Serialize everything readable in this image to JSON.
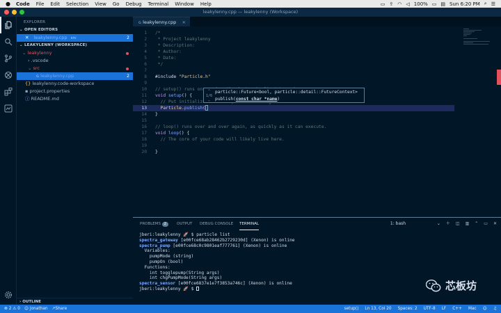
{
  "menubar": {
    "app": "Code",
    "items": [
      "File",
      "Edit",
      "Selection",
      "View",
      "Go",
      "Debug",
      "Terminal",
      "Window",
      "Help"
    ],
    "battery": "100%",
    "clock": "Sun 6:20 PM"
  },
  "window": {
    "title": "leakylenny.cpp — leakylenny (Workspace)"
  },
  "sidebar": {
    "title": "EXPLORER",
    "open_editors_header": "OPEN EDITORS",
    "open_editor_file": "leakylenny.cpp",
    "open_editor_path": "src",
    "workspace_header": "LEAKYLENNY (WORKSPACE)",
    "tree": {
      "root": "leakylenny",
      "vscode": ".vscode",
      "src": "src",
      "cpp": "leakylenny.cpp",
      "cpp_badge": "2",
      "workspace_file": "leakylenny.code-workspace",
      "properties": "project.properties",
      "readme": "README.md"
    },
    "outline_header": "OUTLINE"
  },
  "tab": {
    "label": "leakylenny.cpp",
    "close": "×"
  },
  "editor": {
    "lines": [
      {
        "n": "1",
        "parts": [
          [
            "cmt",
            "/*"
          ]
        ]
      },
      {
        "n": "2",
        "parts": [
          [
            "cmt",
            " * Project leakylenny"
          ]
        ]
      },
      {
        "n": "3",
        "parts": [
          [
            "cmt",
            " * Description:"
          ]
        ]
      },
      {
        "n": "4",
        "parts": [
          [
            "cmt",
            " * Author:"
          ]
        ]
      },
      {
        "n": "5",
        "parts": [
          [
            "cmt",
            " * Date:"
          ]
        ]
      },
      {
        "n": "6",
        "parts": [
          [
            "cmt",
            " */"
          ]
        ]
      },
      {
        "n": "7",
        "parts": []
      },
      {
        "n": "8",
        "parts": [
          [
            "pl",
            "#include "
          ],
          [
            "str",
            "\"Particle.h\""
          ]
        ]
      },
      {
        "n": "9",
        "parts": []
      },
      {
        "n": "10",
        "parts": [
          [
            "cmt",
            "// setup() runs once, when the device is first turned on."
          ]
        ]
      },
      {
        "n": "11",
        "parts": [
          [
            "kw",
            "void "
          ],
          [
            "fn",
            "setup"
          ],
          [
            "pl",
            "() {"
          ]
        ]
      },
      {
        "n": "12",
        "parts": [
          [
            "cmt",
            "  // Put initialization like pinMode and begin functions here."
          ]
        ]
      },
      {
        "n": "13",
        "parts": [
          [
            "pl",
            "  "
          ],
          [
            "cl",
            "Particle"
          ],
          [
            "pl",
            "."
          ],
          [
            "fn",
            "publish"
          ],
          [
            "pl",
            "("
          ]
        ]
      },
      {
        "n": "14",
        "parts": [
          [
            "pl",
            "}"
          ]
        ]
      },
      {
        "n": "15",
        "parts": []
      },
      {
        "n": "16",
        "parts": [
          [
            "cmt",
            "// loop() runs over and over again, as quickly as it can execute."
          ]
        ]
      },
      {
        "n": "17",
        "parts": [
          [
            "kw",
            "void "
          ],
          [
            "fn",
            "loop"
          ],
          [
            "pl",
            "() {"
          ]
        ]
      },
      {
        "n": "18",
        "parts": [
          [
            "cmt",
            "  // The core of your code will likely live here."
          ]
        ]
      },
      {
        "n": "19",
        "parts": []
      },
      {
        "n": "20",
        "parts": [
          [
            "pl",
            "}"
          ]
        ]
      }
    ],
    "current_line": "13"
  },
  "hover": {
    "counter": "1/6",
    "signature_1": "particle::Future<bool, particle::detail::FutureContext>",
    "signature_2_prefix": "publish(",
    "signature_2_param": "const char *name",
    "signature_2_suffix": ")"
  },
  "panel": {
    "tabs": [
      "PROBLEMS",
      "OUTPUT",
      "DEBUG CONSOLE",
      "TERMINAL"
    ],
    "problems_count": "2",
    "terminal_select": "1: bash",
    "terminal": [
      {
        "text": "jberi:leakylenny 🚀 $ particle list",
        "style": "pl"
      },
      {
        "text": "spectra_gateway [e00fce68ab28462b2729230d] (Xenon) is online",
        "style": "tb",
        "bold": "spectra_gateway"
      },
      {
        "text": "spectra_pump [e00fce68c0c9801eaf777761] (Xenon) is online",
        "style": "tb",
        "bold": "spectra_pump"
      },
      {
        "text": "  Variables:",
        "style": "pl"
      },
      {
        "text": "    pumpMode (string)",
        "style": "pl"
      },
      {
        "text": "    pumpOn (bool)",
        "style": "pl"
      },
      {
        "text": "  Functions:",
        "style": "pl"
      },
      {
        "text": "    int togglepump(String args)",
        "style": "pl"
      },
      {
        "text": "    int chgPumpMode(String args)",
        "style": "pl"
      },
      {
        "text": "spectra_sensor [e00fce6837e1e7f3853a746c] (Xenon) is online",
        "style": "tb",
        "bold": "spectra_sensor"
      },
      {
        "text": "jberi:leakylenny 🚀 $ ",
        "style": "pl"
      }
    ]
  },
  "status": {
    "errors": "2",
    "warnings": "0",
    "user": "Jonathan",
    "share": "Share",
    "function": "setup()",
    "position": "Ln 13, Col 20",
    "spaces": "Spaces: 2",
    "encoding": "UTF-8",
    "eol": "LF",
    "language": "C++",
    "platform": "Mac"
  },
  "watermark": {
    "text": "芯板坊"
  }
}
